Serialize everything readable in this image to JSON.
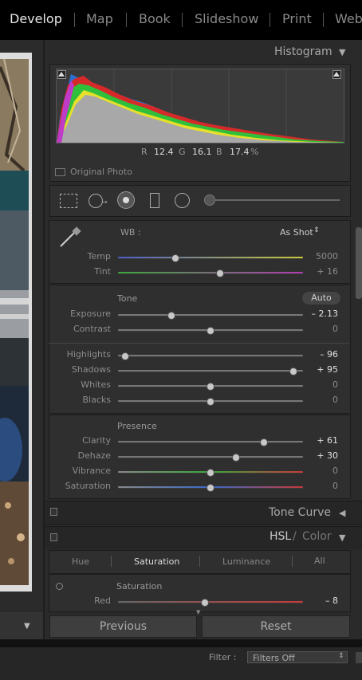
{
  "modules": [
    "Develop",
    "Map",
    "Book",
    "Slideshow",
    "Print",
    "Web"
  ],
  "histogram": {
    "title": "Histogram",
    "r_label": "R",
    "r_value": "12.4",
    "g_label": "G",
    "g_value": "16.1",
    "b_label": "B",
    "b_value": "17.4",
    "pct": "%",
    "original_photo": "Original Photo"
  },
  "basic": {
    "wb_label": "WB :",
    "wb_value": "As Shot",
    "temp": {
      "label": "Temp",
      "value": "5000",
      "level": 0.31
    },
    "tint": {
      "label": "Tint",
      "value": "+ 16",
      "level": 0.55
    },
    "tone_label": "Tone",
    "auto_label": "Auto",
    "exposure": {
      "label": "Exposure",
      "value": "– 2.13",
      "level": 0.29
    },
    "contrast": {
      "label": "Contrast",
      "value": "0",
      "level": 0.5
    },
    "highlights": {
      "label": "Highlights",
      "value": "– 96",
      "level": 0.04
    },
    "shadows": {
      "label": "Shadows",
      "value": "+ 95",
      "level": 0.95
    },
    "whites": {
      "label": "Whites",
      "value": "0",
      "level": 0.5
    },
    "blacks": {
      "label": "Blacks",
      "value": "0",
      "level": 0.5
    },
    "presence_label": "Presence",
    "clarity": {
      "label": "Clarity",
      "value": "+ 61",
      "level": 0.79
    },
    "dehaze": {
      "label": "Dehaze",
      "value": "+ 30",
      "level": 0.64
    },
    "vibrance": {
      "label": "Vibrance",
      "value": "0",
      "level": 0.5
    },
    "saturation": {
      "label": "Saturation",
      "value": "0",
      "level": 0.5
    }
  },
  "tone_curve": {
    "title": "Tone Curve"
  },
  "hsl": {
    "title_hsl": "HSL",
    "title_sep": " / ",
    "title_color": "Color",
    "tabs": [
      "Hue",
      "Saturation",
      "Luminance",
      "All"
    ],
    "section": "Saturation",
    "red": {
      "label": "Red",
      "value": "– 8",
      "level": 0.47
    }
  },
  "buttons": {
    "previous": "Previous",
    "reset": "Reset"
  },
  "filter": {
    "label": "Filter :",
    "value": "Filters Off"
  }
}
